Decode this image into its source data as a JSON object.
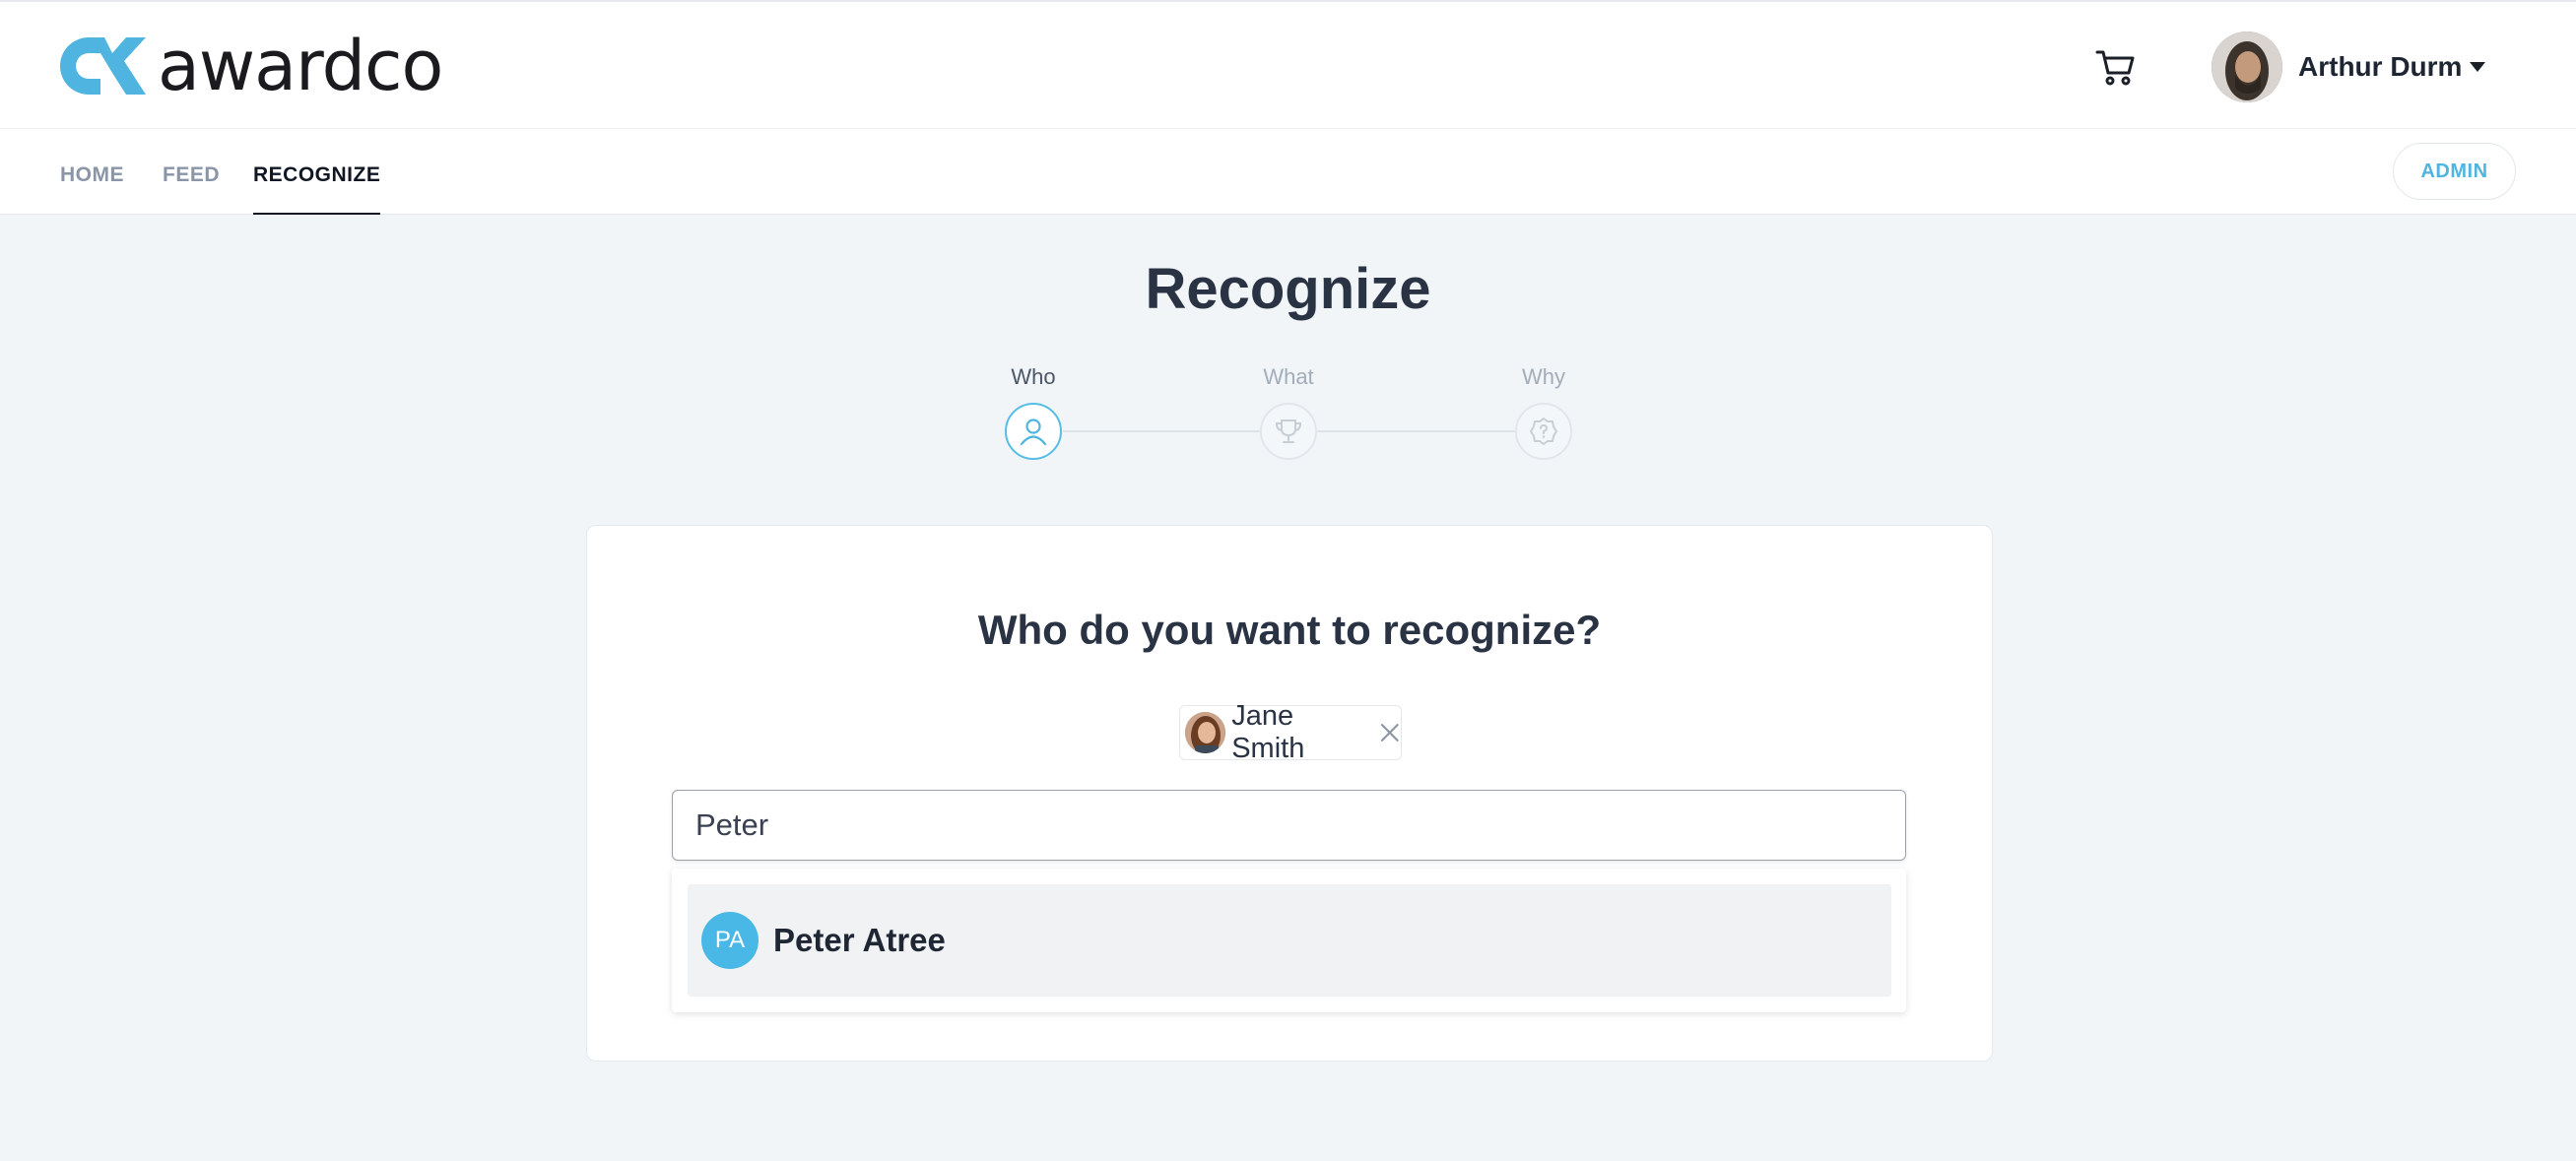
{
  "brand": {
    "name": "awardco",
    "accent": "#4fb5e0"
  },
  "header": {
    "cart_icon": "shopping-cart-icon",
    "user_name": "Arthur Durm",
    "caret_icon": "caret-down-icon"
  },
  "nav": {
    "items": [
      {
        "label": "HOME",
        "active": false
      },
      {
        "label": "FEED",
        "active": false
      },
      {
        "label": "RECOGNIZE",
        "active": true
      }
    ],
    "admin_label": "ADMIN"
  },
  "page": {
    "title": "Recognize",
    "steps": [
      {
        "label": "Who",
        "icon": "user-icon",
        "active": true
      },
      {
        "label": "What",
        "icon": "trophy-icon",
        "active": false
      },
      {
        "label": "Why",
        "icon": "question-badge-icon",
        "active": false
      }
    ]
  },
  "card": {
    "question": "Who do you want to recognize?",
    "selected": [
      {
        "name": "Jane Smith",
        "remove_icon": "close-icon"
      }
    ],
    "search": {
      "value": "Peter"
    },
    "results": [
      {
        "initials": "PA",
        "name": "Peter Atree"
      }
    ]
  }
}
